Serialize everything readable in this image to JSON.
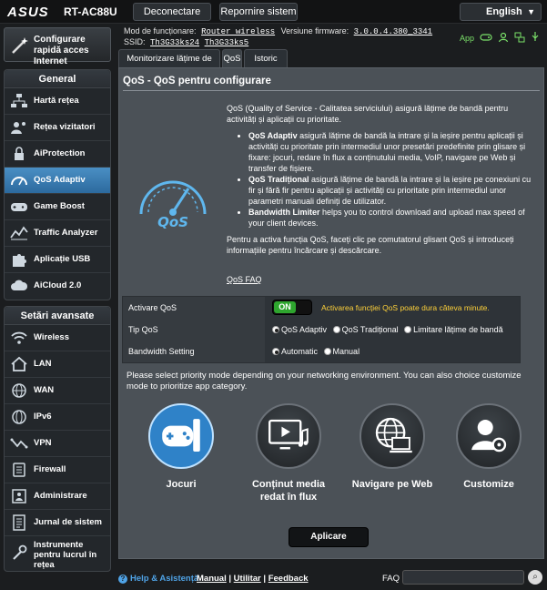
{
  "brand": "ASUS",
  "model": "RT-AC88U",
  "top": {
    "logout": "Deconectare",
    "reboot": "Repornire sistem",
    "language": "English"
  },
  "status": {
    "mode_label": "Mod de funcționare:",
    "mode_value": "Router wireless",
    "fw_label": "Versiune firmware:",
    "fw_value": "3.0.0.4.380_3341",
    "ssid_label": "SSID:",
    "ssid1": "Th3G33ks24",
    "ssid2": "Th3G33ks5",
    "app_label": "App"
  },
  "sidebar": {
    "quick_setup": "Configurare rapidă acces Internet",
    "general_title": "General",
    "general_items": [
      {
        "label": "Hartă rețea",
        "icon": "network-map-icon"
      },
      {
        "label": "Rețea vizitatori",
        "icon": "guest-network-icon"
      },
      {
        "label": "AiProtection",
        "icon": "lock-icon"
      },
      {
        "label": "QoS Adaptiv",
        "icon": "qos-gauge-icon"
      },
      {
        "label": "Game Boost",
        "icon": "gamepad-icon"
      },
      {
        "label": "Traffic Analyzer",
        "icon": "traffic-chart-icon"
      },
      {
        "label": "Aplicație USB",
        "icon": "puzzle-icon"
      },
      {
        "label": "AiCloud 2.0",
        "icon": "cloud-icon"
      }
    ],
    "advanced_title": "Setări avansate",
    "advanced_items": [
      {
        "label": "Wireless",
        "icon": "wifi-icon"
      },
      {
        "label": "LAN",
        "icon": "home-icon"
      },
      {
        "label": "WAN",
        "icon": "globe-icon"
      },
      {
        "label": "IPv6",
        "icon": "ipv6-globe-icon"
      },
      {
        "label": "VPN",
        "icon": "vpn-icon"
      },
      {
        "label": "Firewall",
        "icon": "firewall-icon"
      },
      {
        "label": "Administrare",
        "icon": "admin-icon"
      },
      {
        "label": "Jurnal de sistem",
        "icon": "log-icon"
      },
      {
        "label": "Instrumente pentru lucrul în rețea",
        "icon": "tools-icon"
      }
    ]
  },
  "tabs": [
    "Monitorizare lățime de bandă",
    "QoS",
    "Istoric Web"
  ],
  "main": {
    "title": "QoS - QoS pentru configurare",
    "intro": "QoS (Quality of Service - Calitatea serviciului) asigură lățime de bandă pentru activități și aplicații cu prioritate.",
    "bullet1_head": "QoS Adaptiv",
    "bullet1_text": " asigură lățime de bandă la intrare și la ieșire pentru aplicații și activități cu prioritate prin intermediul unor presetări predefinite prin glisare și fixare: jocuri, redare în flux a conținutului media, VoIP, navigare pe Web și transfer de fișiere.",
    "bullet2_head": "QoS Tradițional",
    "bullet2_text": " asigură lățime de bandă la intrare și la ieșire pe conexiuni cu fir și fără fir pentru aplicații și activități cu prioritate prin intermediul unor parametri manuali definiți de utilizator.",
    "bullet3_head": "Bandwidth Limiter",
    "bullet3_text": " helps you to control download and upload max speed of your client devices.",
    "enable_text": "Pentru a activa funcția QoS, faceți clic pe comutatorul glisant QoS și introduceți informațiile pentru încărcare și descărcare.",
    "faq_link": "QoS FAQ",
    "logo_text": "QoS",
    "settings": {
      "enable_label": "Activare QoS",
      "toggle_on": "ON",
      "enable_warning": "Activarea funcției QoS poate dura câteva minute.",
      "type_label": "Tip QoS",
      "type_options": [
        "QoS Adaptiv",
        "QoS Tradițional",
        "Limitare lățime de bandă"
      ],
      "type_selected": 0,
      "bw_label": "Bandwidth Setting",
      "bw_options": [
        "Automatic",
        "Manual"
      ],
      "bw_selected": 0
    },
    "priority_text": "Please select priority mode depending on your networking environment. You can also choice customize mode to prioritize app category.",
    "modes": [
      {
        "label": "Jocuri",
        "icon": "gamepad-icon"
      },
      {
        "label": "Conținut media redat în flux",
        "icon": "media-stream-icon"
      },
      {
        "label": "Navigare pe Web",
        "icon": "web-browsing-icon"
      },
      {
        "label": "Customize",
        "icon": "user-settings-icon"
      }
    ],
    "active_mode": 0,
    "apply": "Aplicare"
  },
  "footer": {
    "help": "Help & Asistență",
    "manual": "Manual",
    "utility": "Utilitar",
    "feedback": "Feedback",
    "faq": "FAQ"
  },
  "colors": {
    "accent_blue": "#2f82c8",
    "toggle_green": "#2ea52e",
    "warning_yellow": "#ffd23a",
    "status_green": "#7be26a"
  }
}
